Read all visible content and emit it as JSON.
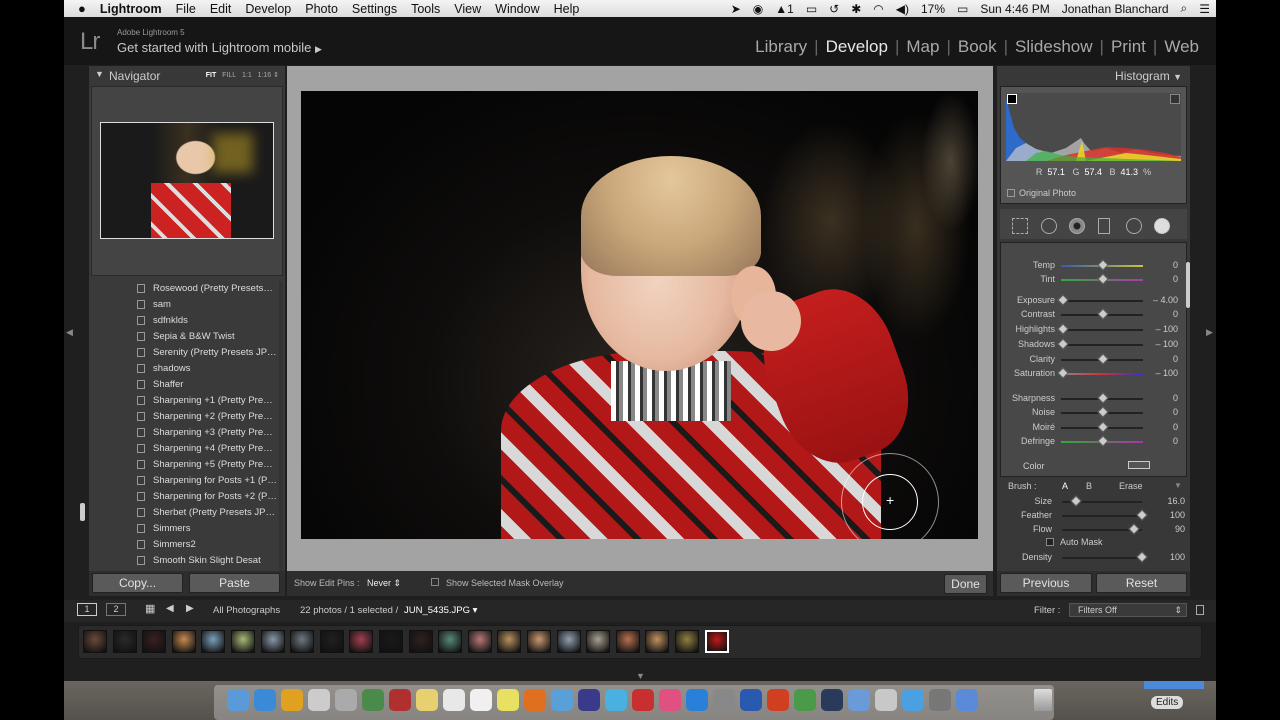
{
  "menubar": {
    "apple": "",
    "app": "Lightroom",
    "items": [
      "File",
      "Edit",
      "Develop",
      "Photo",
      "Settings",
      "Tools",
      "View",
      "Window",
      "Help"
    ],
    "battery": "17%",
    "clock": "Sun 4:46 PM",
    "user": "Jonathan Blanchard",
    "status_icons": [
      "location-icon",
      "record-icon",
      "adobe-icon",
      "airplay-icon",
      "time-machine-icon",
      "bluetooth-icon",
      "wifi-icon",
      "volume-icon",
      "battery-icon",
      "search-icon",
      "list-icon"
    ],
    "adobe_count": "1"
  },
  "identity": {
    "logo": "Lr",
    "product": "Adobe Lightroom 5",
    "subtitle": "Get started with Lightroom mobile",
    "subtitle_arrow": "▶"
  },
  "modules": {
    "items": [
      "Library",
      "Develop",
      "Map",
      "Book",
      "Slideshow",
      "Print",
      "Web"
    ],
    "active": "Develop",
    "separator": "|"
  },
  "navigator": {
    "title": "Navigator",
    "zoom_options": [
      "FIT",
      "FILL",
      "1:1",
      "1:16"
    ]
  },
  "presets": [
    "Rosewood (Pretty Presets…",
    "sam",
    "sdfnklds",
    "Sepia & B&W Twist",
    "Serenity (Pretty Presets JP…",
    "shadows",
    "Shaffer",
    "Sharpening +1 (Pretty Presets)",
    "Sharpening +2 (Pretty Presets)",
    "Sharpening +3 (Pretty Presets)",
    "Sharpening +4 (Pretty Presets)",
    "Sharpening +5 (Pretty Presets)",
    "Sharpening for Posts +1 (P…",
    "Sharpening for Posts +2 (P…",
    "Sherbet (Pretty Presets JPE…",
    "Simmers",
    "Simmers2",
    "Smooth Skin Slight Desat"
  ],
  "left_buttons": {
    "copy": "Copy...",
    "paste": "Paste"
  },
  "toolbar": {
    "show_edit_pins_label": "Show Edit Pins :",
    "show_edit_pins_value": "Never",
    "show_mask_overlay": "Show Selected Mask Overlay",
    "done": "Done"
  },
  "histogram": {
    "title": "Histogram",
    "r_label": "R",
    "r": "57.1",
    "g_label": "G",
    "g": "57.4",
    "b_label": "B",
    "b": "41.3",
    "pct": "%",
    "original_photo": "Original Photo"
  },
  "adjustments": [
    {
      "label": "Temp",
      "value": "0",
      "pos": 0.5
    },
    {
      "label": "Tint",
      "value": "0",
      "pos": 0.5
    },
    {
      "label": "Exposure",
      "value": "– 4.00",
      "pos": 0.0
    },
    {
      "label": "Contrast",
      "value": "0",
      "pos": 0.5
    },
    {
      "label": "Highlights",
      "value": "– 100",
      "pos": 0.0
    },
    {
      "label": "Shadows",
      "value": "– 100",
      "pos": 0.0
    },
    {
      "label": "Clarity",
      "value": "0",
      "pos": 0.5
    },
    {
      "label": "Saturation",
      "value": "– 100",
      "pos": 0.0
    },
    {
      "label": "Sharpness",
      "value": "0",
      "pos": 0.5
    },
    {
      "label": "Noise",
      "value": "0",
      "pos": 0.5
    },
    {
      "label": "Moiré",
      "value": "0",
      "pos": 0.5
    },
    {
      "label": "Defringe",
      "value": "0",
      "pos": 0.5
    }
  ],
  "color_label": "Color",
  "brush": {
    "label": "Brush :",
    "a": "A",
    "b": "B",
    "erase": "Erase",
    "size_label": "Size",
    "size": "16.0",
    "size_pos": 0.15,
    "feather_label": "Feather",
    "feather": "100",
    "feather_pos": 1.0,
    "flow_label": "Flow",
    "flow": "90",
    "flow_pos": 0.9,
    "automask": "Auto Mask",
    "density_label": "Density",
    "density": "100",
    "density_pos": 1.0
  },
  "right_buttons": {
    "previous": "Previous",
    "reset": "Reset"
  },
  "filmbar": {
    "view1": "1",
    "view2": "2",
    "source": "All Photographs",
    "count": "22 photos / 1 selected /",
    "filename": "JUN_5435.JPG",
    "filter_label": "Filter :",
    "filter_value": "Filters Off"
  },
  "filmstrip_count": 22,
  "dock": {
    "edits": "Edits"
  }
}
